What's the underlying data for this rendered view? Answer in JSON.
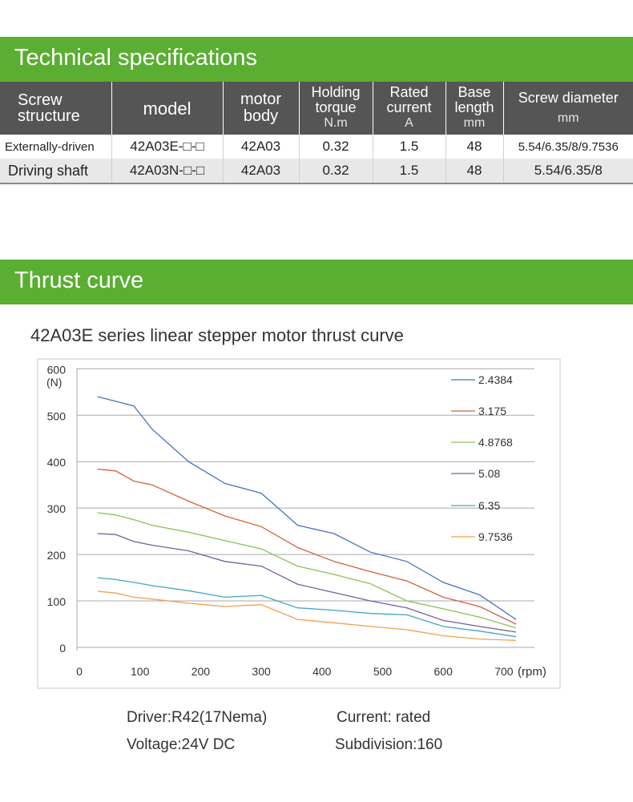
{
  "spec_section": {
    "title": "Technical specifications",
    "headers": [
      {
        "lines": [
          "Screw",
          "structure"
        ],
        "unit": ""
      },
      {
        "lines": [
          "model"
        ],
        "unit": ""
      },
      {
        "lines": [
          "motor",
          "body"
        ],
        "unit": ""
      },
      {
        "lines": [
          "Holding",
          "torque"
        ],
        "unit": "N.m"
      },
      {
        "lines": [
          "Rated",
          "current"
        ],
        "unit": "A"
      },
      {
        "lines": [
          "Base",
          "length"
        ],
        "unit": "mm"
      },
      {
        "lines": [
          "Screw diameter"
        ],
        "unit": "mm"
      }
    ],
    "rows": [
      [
        "Externally-driven",
        "42A03E-□-□",
        "42A03",
        "0.32",
        "1.5",
        "48",
        "5.54/6.35/8/9.7536"
      ],
      [
        "Driving shaft",
        "42A03N-□-□",
        "42A03",
        "0.32",
        "1.5",
        "48",
        "5.54/6.35/8"
      ]
    ]
  },
  "thrust_section": {
    "title": "Thrust curve"
  },
  "chart_data": {
    "type": "line",
    "title": "42A03E series linear stepper motor thrust curve",
    "ylabel": "(N)",
    "xlabel": "(rpm)",
    "xlim": [
      0,
      750
    ],
    "ylim": [
      0,
      600
    ],
    "x_ticks": [
      0,
      100,
      200,
      300,
      400,
      500,
      600,
      700
    ],
    "y_ticks": [
      0,
      100,
      200,
      300,
      400,
      500,
      600
    ],
    "grid": "horizontal",
    "legend_position": "top-right",
    "x": [
      30,
      60,
      90,
      120,
      180,
      240,
      300,
      360,
      420,
      480,
      540,
      600,
      660,
      720
    ],
    "series": [
      {
        "name": "2.4384",
        "color": "#4472c4",
        "values": [
          540,
          530,
          520,
          470,
          400,
          353,
          332,
          263,
          245,
          205,
          185,
          140,
          113,
          60
        ]
      },
      {
        "name": "3.175",
        "color": "#d2603a",
        "values": [
          384,
          380,
          358,
          350,
          315,
          283,
          260,
          215,
          185,
          163,
          143,
          108,
          88,
          50
        ]
      },
      {
        "name": "4.8768",
        "color": "#8cc05a",
        "values": [
          290,
          285,
          275,
          263,
          248,
          230,
          212,
          175,
          157,
          137,
          100,
          83,
          65,
          42
        ]
      },
      {
        "name": "5.08",
        "color": "#7a5c9e",
        "values": [
          245,
          243,
          228,
          220,
          208,
          185,
          175,
          136,
          118,
          100,
          85,
          58,
          45,
          33
        ]
      },
      {
        "name": "6.35",
        "color": "#43a4c4",
        "values": [
          150,
          146,
          140,
          133,
          122,
          108,
          112,
          85,
          80,
          73,
          70,
          45,
          35,
          23
        ]
      },
      {
        "name": "9.7536",
        "color": "#f0a050",
        "values": [
          121,
          117,
          108,
          104,
          95,
          88,
          92,
          60,
          53,
          45,
          38,
          25,
          18,
          15
        ]
      }
    ]
  },
  "notes": {
    "driver": "Driver:R42(17Nema)",
    "voltage": "Voltage:24V DC",
    "current": "Current: rated",
    "subdivision": "Subdivision:160"
  }
}
